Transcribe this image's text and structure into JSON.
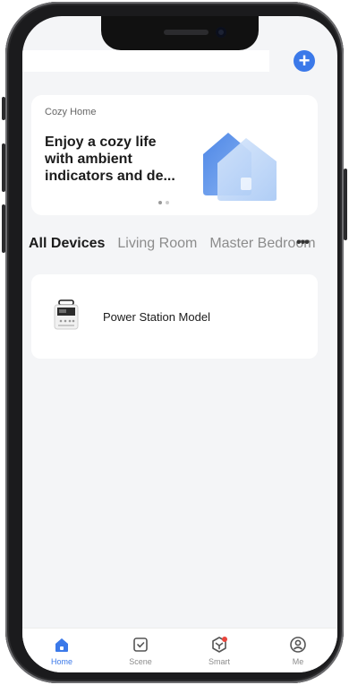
{
  "header": {
    "add_icon": "plus-icon",
    "accent": "#3b79e9"
  },
  "banner": {
    "tag": "Cozy Home",
    "title": "Enjoy a cozy life with ambient indicators and de...",
    "art_icon": "house-icon",
    "page_dots": 2,
    "active_dot": 1
  },
  "tabs": {
    "items": [
      "All Devices",
      "Living Room",
      "Master Bedroom"
    ],
    "active": "All Devices",
    "more_label": "•••"
  },
  "devices": [
    {
      "name": "Power Station Model",
      "icon": "power-station-icon"
    }
  ],
  "bottom_nav": [
    {
      "label": "Home",
      "icon": "home-icon",
      "active": true
    },
    {
      "label": "Scene",
      "icon": "scene-check-icon",
      "active": false
    },
    {
      "label": "Smart",
      "icon": "smart-cube-icon",
      "active": false,
      "badge": true
    },
    {
      "label": "Me",
      "icon": "profile-icon",
      "active": false
    }
  ]
}
